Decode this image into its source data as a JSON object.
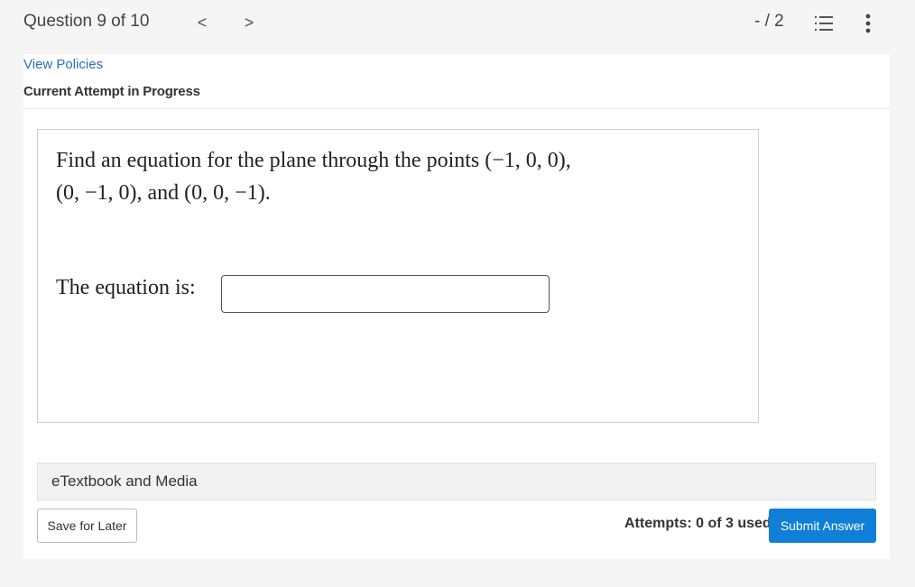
{
  "header": {
    "question_counter": "Question 9 of 10",
    "prev_glyph": "<",
    "next_glyph": ">",
    "score": "- / 2"
  },
  "panel": {
    "view_policies": "View Policies",
    "attempt_status": "Current Attempt in Progress"
  },
  "question": {
    "prompt_line1": "Find an equation for the plane through the points (−1, 0, 0),",
    "prompt_line2": "(0, −1, 0), and (0, 0, −1).",
    "equation_label": "The equation is:",
    "answer_value": "",
    "answer_placeholder": ""
  },
  "resources": {
    "etextbook_label": "eTextbook and Media"
  },
  "footer": {
    "save_label": "Save for Later",
    "attempts_text": "Attempts: 0 of 3 used",
    "submit_label": "Submit Answer"
  },
  "colors": {
    "link": "#2a6ebb",
    "primary_button": "#0f7fd8",
    "page_background": "#f5f5f5"
  },
  "icons": {
    "prev": "chevron-left-icon",
    "next": "chevron-right-icon",
    "question_list": "numbered-list-icon",
    "more": "more-vertical-icon"
  }
}
